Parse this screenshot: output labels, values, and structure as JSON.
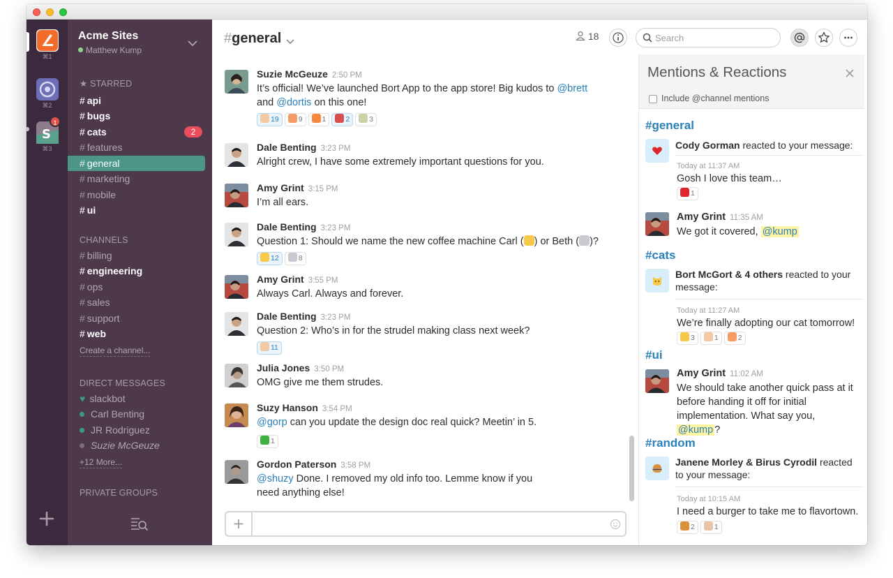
{
  "teams": [
    {
      "shortcut": "⌘1"
    },
    {
      "shortcut": "⌘2"
    },
    {
      "shortcut": "⌘3",
      "badge": "1"
    }
  ],
  "sidebar": {
    "team_name": "Acme Sites",
    "user_name": "Matthew Kump",
    "starred_label": "STARRED",
    "starred": [
      {
        "name": "api",
        "bold": true
      },
      {
        "name": "bugs",
        "bold": true
      },
      {
        "name": "cats",
        "bold": true,
        "count": "2"
      },
      {
        "name": "features"
      },
      {
        "name": "general",
        "active": true
      },
      {
        "name": "marketing"
      },
      {
        "name": "mobile"
      },
      {
        "name": "ui",
        "bold": true
      }
    ],
    "channels_label": "CHANNELS",
    "channels": [
      {
        "name": "billing"
      },
      {
        "name": "engineering",
        "bold": true
      },
      {
        "name": "ops"
      },
      {
        "name": "sales"
      },
      {
        "name": "support"
      },
      {
        "name": "web",
        "bold": true
      }
    ],
    "create_channel": "Create a channel...",
    "dm_label": "DIRECT MESSAGES",
    "dms": [
      {
        "name": "slackbot"
      },
      {
        "name": "Carl Benting"
      },
      {
        "name": "JR Rodriguez"
      },
      {
        "name": "Suzie McGeuze"
      }
    ],
    "more_dms": "+12 More...",
    "private_label": "PRIVATE GROUPS"
  },
  "header": {
    "channel": "general",
    "members": "18",
    "search_placeholder": "Search"
  },
  "messages": [
    {
      "author": "Suzie McGeuze",
      "time": "2:50 PM",
      "text_a": "It’s official! We’ve launched Bort App to the app store! Big kudos to ",
      "mention_a": "@brett",
      "text_b": " and ",
      "mention_b": "@dortis",
      "text_c": " on this one!",
      "reactions": [
        {
          "count": "19",
          "mine": true
        },
        {
          "count": "9"
        },
        {
          "count": "1"
        },
        {
          "count": "2",
          "mine": true
        },
        {
          "count": "3"
        }
      ]
    },
    {
      "author": "Dale Benting",
      "time": "3:23 PM",
      "text": "Alright crew, I have some extremely important questions for you."
    },
    {
      "author": "Amy Grint",
      "time": "3:15 PM",
      "text": "I’m all ears."
    },
    {
      "author": "Dale Benting",
      "time": "3:23 PM",
      "text_a": "Question 1: Should we name the new coffee machine Carl (",
      "text_b": ") or Beth (",
      "text_c": ")?",
      "reactions": [
        {
          "count": "12",
          "mine": true
        },
        {
          "count": "8"
        }
      ]
    },
    {
      "author": "Amy Grint",
      "time": "3:55 PM",
      "text": "Always Carl. Always and forever."
    },
    {
      "author": "Dale Benting",
      "time": "3:23 PM",
      "text": "Question 2: Who’s in for the strudel making class next week?",
      "reactions": [
        {
          "count": "11",
          "mine": true
        }
      ]
    },
    {
      "author": "Julia Jones",
      "time": "3:50 PM",
      "text": "OMG give me them strudes."
    },
    {
      "author": "Suzy Hanson",
      "time": "3:54 PM",
      "mention_a": "@gorp",
      "text_a": " can you update the design doc real quick? Meetin’ in 5.",
      "reactions": [
        {
          "count": "1"
        }
      ]
    },
    {
      "author": "Gordon Paterson",
      "time": "3:58 PM",
      "mention_a": "@shuzy",
      "text_a": " Done. I removed my old info too. Lemme know if you need anything else!"
    }
  ],
  "panel": {
    "title": "Mentions & Reactions",
    "include_label": "Include @channel mentions",
    "groups": [
      {
        "channel": "#general"
      },
      {
        "channel": "#cats"
      },
      {
        "channel": "#ui"
      },
      {
        "channel": "#random"
      }
    ],
    "items": {
      "g1_who": "Cody Gorman",
      "g1_rest": " reacted to your message:",
      "g1_time": "Today at 11:37 AM",
      "g1_text": "Gosh I love this team…",
      "g1_react": "1",
      "g2_author": "Amy Grint",
      "g2_time": "11:35 AM",
      "g2_text": "We got it covered, ",
      "g2_mention": "@kump",
      "c1_who": "Bort McGort & 4 others",
      "c1_rest": " reacted to your message:",
      "c1_time": "Today at 11:27 AM",
      "c1_text": "We’re finally adopting our cat tomorrow!",
      "c1_reacts": [
        "3",
        "1",
        "2"
      ],
      "u1_author": "Amy Grint",
      "u1_time": "11:02 AM",
      "u1_text": "We should take another quick pass at it before handing it off for initial implementation. What say you, ",
      "u1_mention": "@kump",
      "u1_end": "?",
      "r1_who": "Janene Morley & Birus Cyrodil",
      "r1_rest": " reacted to your message:",
      "r1_time": "Today at 10:15 AM",
      "r1_text": "I need a burger to take me to flavortown.",
      "r1_reacts": [
        "2",
        "1"
      ]
    }
  },
  "colors": {
    "sidebar": "#4d394b",
    "teams": "#3b2a3e",
    "active": "#4c9689",
    "link": "#2a80b9",
    "badge": "#eb4d5c"
  }
}
